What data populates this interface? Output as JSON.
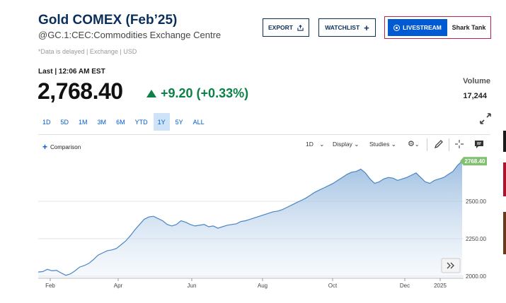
{
  "header": {
    "title": "Gold COMEX (Feb’25)",
    "subtitle": "@GC.1:CEC:Commodities Exchange Centre",
    "delay_note": "*Data is delayed | Exchange | USD"
  },
  "actions": {
    "export_label": "EXPORT",
    "watchlist_label": "WATCHLIST",
    "livestream_label": "LIVESTREAM",
    "show_label": "Shark Tank"
  },
  "quote": {
    "last_label": "Last | 12:06 AM EST",
    "price": "2,768.40",
    "change": "+9.20 (+0.33%)",
    "volume_label": "Volume",
    "volume_value": "17,244"
  },
  "ranges": [
    "1D",
    "5D",
    "1M",
    "3M",
    "6M",
    "YTD",
    "1Y",
    "5Y",
    "ALL"
  ],
  "active_range": "1Y",
  "toolbar": {
    "comparison_label": "Comparison",
    "interval_label": "1D",
    "display_label": "Display",
    "studies_label": "Studies"
  },
  "chart_data": {
    "type": "area",
    "x_ticks": [
      "Feb",
      "Apr",
      "Jun",
      "Aug",
      "Oct",
      "Dec",
      "2025"
    ],
    "y_ticks": [
      "2500.00",
      "2250.00",
      "2000.00"
    ],
    "ylim": [
      1985,
      2760
    ],
    "last_value_label": "2768.40",
    "accent_color": "#4a86c5",
    "last_tag_color": "#7fc16f",
    "series": [
      {
        "values": [
          2027,
          2030,
          2045,
          2035,
          2038,
          2020,
          2005,
          2015,
          2035,
          2060,
          2070,
          2085,
          2110,
          2140,
          2155,
          2170,
          2175,
          2185,
          2210,
          2235,
          2270,
          2310,
          2345,
          2380,
          2395,
          2400,
          2385,
          2370,
          2345,
          2335,
          2345,
          2370,
          2360,
          2345,
          2335,
          2340,
          2345,
          2330,
          2335,
          2320,
          2330,
          2340,
          2345,
          2350,
          2365,
          2370,
          2380,
          2390,
          2400,
          2410,
          2420,
          2430,
          2435,
          2445,
          2460,
          2475,
          2490,
          2505,
          2520,
          2540,
          2560,
          2575,
          2590,
          2605,
          2620,
          2640,
          2660,
          2680,
          2695,
          2700,
          2715,
          2690,
          2650,
          2620,
          2630,
          2650,
          2660,
          2655,
          2640,
          2650,
          2660,
          2675,
          2690,
          2660,
          2630,
          2620,
          2640,
          2650,
          2660,
          2680,
          2700,
          2740,
          2768.4
        ]
      }
    ]
  }
}
